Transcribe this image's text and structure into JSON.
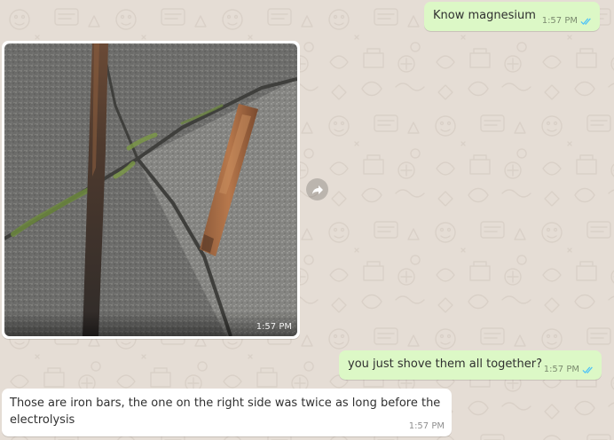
{
  "colors": {
    "wallpaper": "#e5ddd5",
    "outgoing_bubble": "#dcf8c6",
    "incoming_bubble": "#ffffff",
    "read_ticks": "#4fc3f7"
  },
  "messages": [
    {
      "direction": "outgoing",
      "text": "Know magnesium",
      "time": "1:57 PM",
      "status_icon": "double-check-read-icon"
    },
    {
      "direction": "incoming",
      "type": "image",
      "image_description": "photo of two rusted iron bars lying on a cracked concrete pavement",
      "time": "1:57 PM",
      "action_icon": "forward-icon"
    },
    {
      "direction": "outgoing",
      "text": "you just shove them all together?",
      "time": "1:57 PM",
      "status_icon": "double-check-read-icon"
    },
    {
      "direction": "incoming",
      "text_line1": "Those are iron bars, the one on the right side was twice as long before the",
      "text_line2": "electrolysis",
      "time": "1:57 PM"
    }
  ]
}
